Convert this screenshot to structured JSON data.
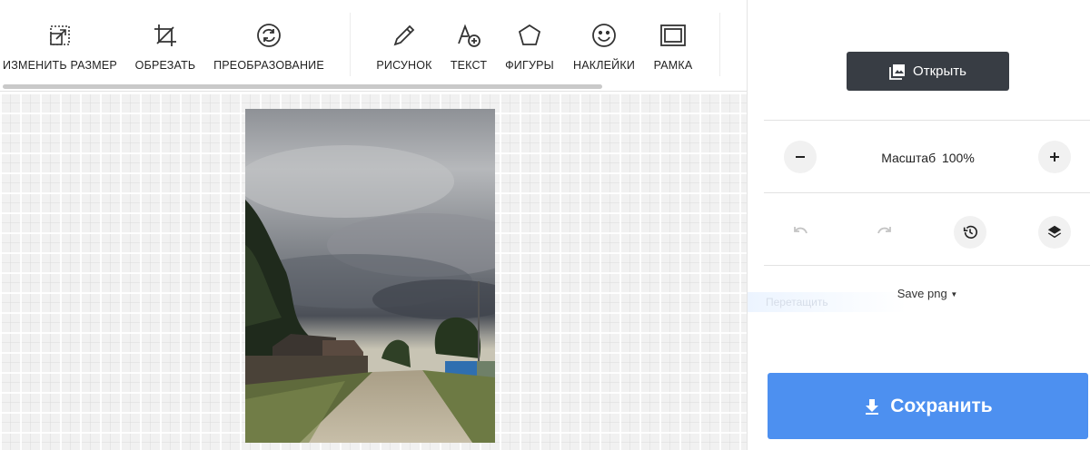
{
  "toolbar": {
    "tools": [
      {
        "label": "ИЗМЕНИТЬ РАЗМЕР",
        "icon": "resize-icon"
      },
      {
        "label": "ОБРЕЗАТЬ",
        "icon": "crop-icon"
      },
      {
        "label": "ПРЕОБРАЗОВАНИЕ",
        "icon": "transform-icon"
      },
      {
        "label": "РИСУНОК",
        "icon": "pencil-icon"
      },
      {
        "label": "ТЕКСТ",
        "icon": "text-add-icon"
      },
      {
        "label": "ФИГУРЫ",
        "icon": "shapes-icon"
      },
      {
        "label": "НАКЛЕЙКИ",
        "icon": "smiley-icon"
      },
      {
        "label": "РАМКА",
        "icon": "frame-icon"
      }
    ]
  },
  "panel": {
    "open_label": "Открыть",
    "zoom_label": "Масштаб  100%",
    "save_format": "Save png",
    "save_label": "Сохранить",
    "ghost_hint": "Перетащить"
  },
  "colors": {
    "dark_button": "#383d44",
    "save_button": "#4d90f0",
    "canvas_bg": "#f1f1f1"
  }
}
